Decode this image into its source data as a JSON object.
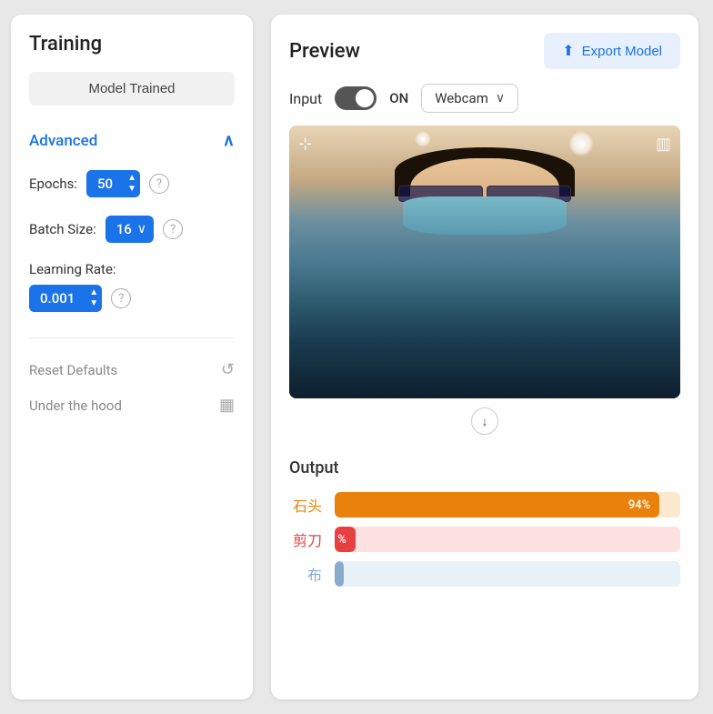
{
  "left": {
    "training_title": "Training",
    "model_trained_btn": "Model Trained",
    "advanced_label": "Advanced",
    "epochs_label": "Epochs:",
    "epochs_value": "50",
    "batch_size_label": "Batch Size:",
    "batch_size_value": "16",
    "learning_rate_label": "Learning Rate:",
    "learning_rate_value": "0.001",
    "reset_defaults_label": "Reset Defaults",
    "under_hood_label": "Under the hood",
    "help_icon": "?",
    "chevron_up": "∧",
    "chevron_down": "∨",
    "reset_icon": "↺",
    "under_hood_icon": "▦"
  },
  "right": {
    "preview_title": "Preview",
    "export_btn_label": "Export Model",
    "input_label": "Input",
    "toggle_state": "ON",
    "webcam_label": "Webcam",
    "crop_icon": "⊡",
    "compare_icon": "▥",
    "scroll_down_icon": "↓",
    "output_title": "Output",
    "bars": [
      {
        "label": "石头",
        "value": 94,
        "display": "94%",
        "class_label": "1"
      },
      {
        "label": "剪刀",
        "value": 6,
        "display": "%",
        "class_label": "2"
      },
      {
        "label": "布",
        "value": 1,
        "display": "",
        "class_label": "3"
      }
    ]
  }
}
